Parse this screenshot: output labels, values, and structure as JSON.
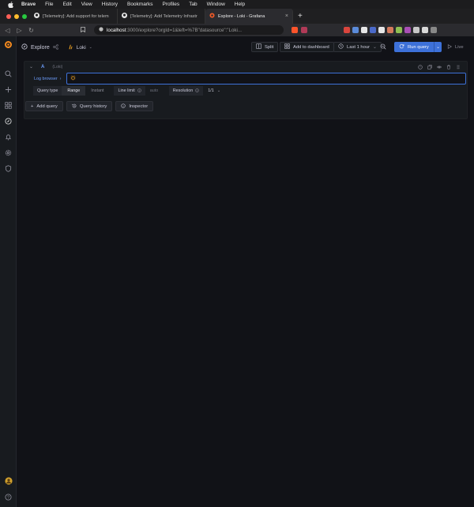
{
  "os_menu": {
    "items": [
      "Brave",
      "File",
      "Edit",
      "View",
      "History",
      "Bookmarks",
      "Profiles",
      "Tab",
      "Window",
      "Help"
    ]
  },
  "tabs": [
    {
      "label": "[Telemetry]: Add support for telem",
      "icon": "github-icon"
    },
    {
      "label": "[Telemetry]: Add Telemetry Infrastr",
      "icon": "github-icon"
    },
    {
      "label": "Explore - Loki - Grafana",
      "icon": "grafana-icon",
      "active": true
    }
  ],
  "address_bar": {
    "host": "localhost",
    "path": ":3000/explore?orgId=1&left=%7B\"datasource\":\"Loki...",
    "url_full": "localhost:3000/explore?orgId=1&left=%7B\"datasource\":\"Loki..."
  },
  "grafana": {
    "page_title": "Explore",
    "datasource": "Loki",
    "toolbar": {
      "split": "Split",
      "add_to_dashboard": "Add to dashboard",
      "time_range": "Last 1 hour",
      "run_query": "Run query",
      "live": "Live"
    },
    "query": {
      "ref_id": "A",
      "datasource_tag": "(Loki)",
      "log_browser": "Log browser",
      "query_text": "",
      "options": {
        "query_type_label": "Query type",
        "range": "Range",
        "instant": "Instant",
        "line_limit_label": "Line limit",
        "line_limit_placeholder": "auto",
        "resolution_label": "Resolution",
        "resolution_value": "1/1"
      }
    },
    "actions": {
      "add_query": "Add query",
      "query_history": "Query history",
      "inspector": "Inspector"
    }
  },
  "colors": {
    "accent": "#3d71d9",
    "ref_id": "#6e9fff",
    "background": "#111217",
    "panel": "#181b1f"
  }
}
